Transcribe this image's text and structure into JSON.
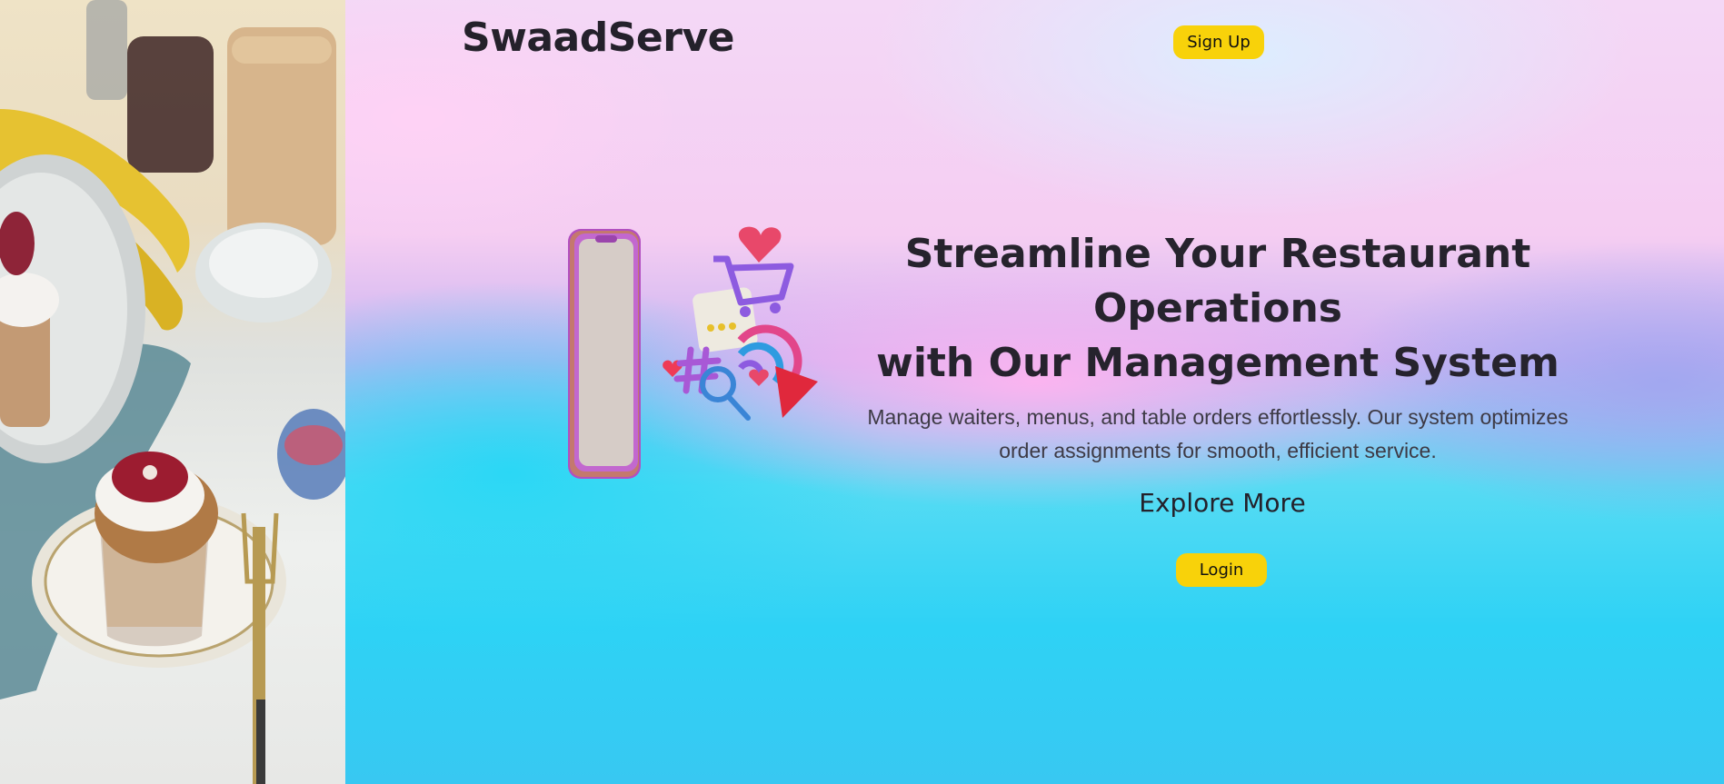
{
  "app": {
    "brand": "SwaadServe"
  },
  "header": {
    "signup_label": "Sign Up"
  },
  "hero": {
    "headline_line1": "Streamline Your Restaurant",
    "headline_line2": "Operations",
    "headline_line3": "with Our Management System",
    "description": "Manage waiters, menus, and table orders effortlessly. Our system optimizes order assignments for smooth, efficient service.",
    "explore_label": "Explore More",
    "login_label": "Login"
  },
  "side_photo": {
    "subject": "muffins-on-plate-photo"
  },
  "illustration": {
    "subject": "phone-with-shopping-icons"
  },
  "colors": {
    "button": "#f8d20a",
    "text_dark": "#24212b"
  }
}
